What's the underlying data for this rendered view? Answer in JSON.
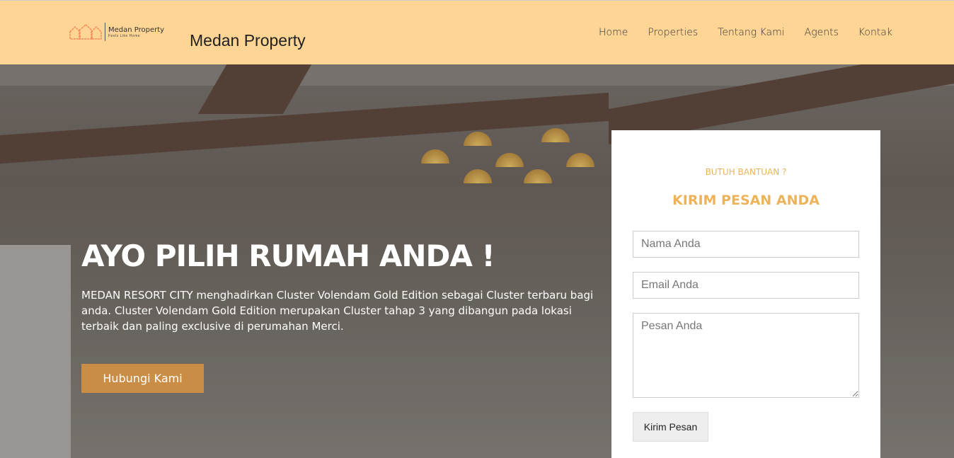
{
  "header": {
    "logo_name": "Medan Property",
    "logo_tagline": "Feels Like Home",
    "site_title": "Medan Property",
    "nav": [
      "Home",
      "Properties",
      "Tentang Kami",
      "Agents",
      "Kontak"
    ]
  },
  "hero": {
    "title": "AYO PILIH RUMAH ANDA !",
    "description": "MEDAN RESORT CITY menghadirkan Cluster Volendam Gold Edition sebagai Cluster terbaru bagi anda. Cluster Volendam Gold Edition merupakan Cluster tahap 3 yang dibangun pada lokasi terbaik dan paling exclusive di perumahan Merci.",
    "cta": "Hubungi Kami"
  },
  "form": {
    "subtitle": "BUTUH BANTUAN ?",
    "title": "KIRIM PESAN ANDA",
    "name_placeholder": "Nama Anda",
    "email_placeholder": "Email Anda",
    "message_placeholder": "Pesan Anda",
    "submit": "Kirim Pesan"
  }
}
